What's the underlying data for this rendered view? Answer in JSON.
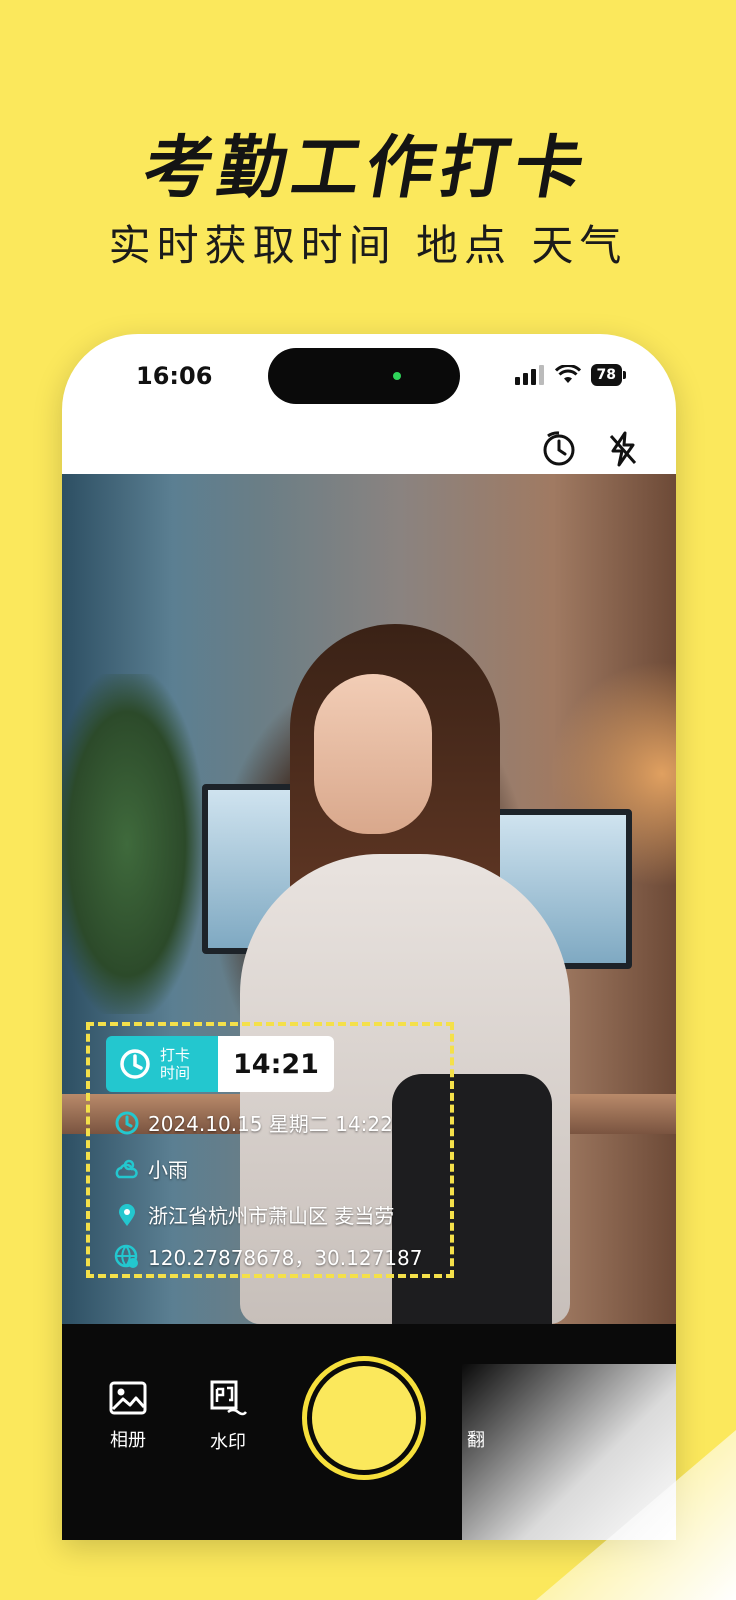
{
  "promo": {
    "headline": "考勤工作打卡",
    "subheadline": "实时获取时间  地点  天气"
  },
  "status_bar": {
    "time": "16:06",
    "battery": "78",
    "icons": [
      "signal-icon",
      "wifi-icon",
      "battery-icon"
    ]
  },
  "camera_top": {
    "icons": [
      "timer-icon",
      "flash-off-icon"
    ]
  },
  "watermark": {
    "punch_label": "打卡\n时间",
    "punch_label_line1": "打卡",
    "punch_label_line2": "时间",
    "punch_time": "14:21",
    "datetime": "2024.10.15 星期二 14:22",
    "weather": "小雨",
    "location": "浙江省杭州市萧山区 麦当劳",
    "coordinates": "120.27878678，30.127187",
    "frame_color": "#f4e04a",
    "badge_color": "#23c7cf"
  },
  "bottom_bar": {
    "album_label": "相册",
    "watermark_label": "水印",
    "flip_label": "翻",
    "shutter_color": "#fbe85c"
  },
  "colors": {
    "background": "#fbe85c",
    "accent": "#23c7cf"
  }
}
